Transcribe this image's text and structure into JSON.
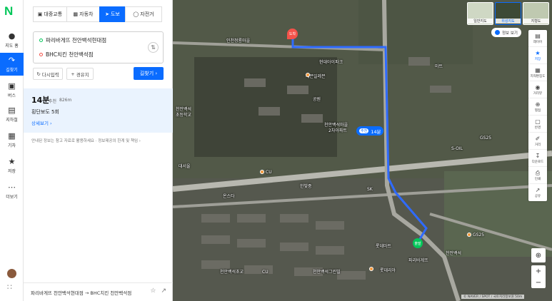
{
  "rail": {
    "logo": "N",
    "items": [
      {
        "label": "지도 홈",
        "icon": "pin-icon"
      },
      {
        "label": "길찾기",
        "icon": "directions-icon"
      },
      {
        "label": "버스",
        "icon": "bus-icon"
      },
      {
        "label": "지하철",
        "icon": "subway-icon"
      },
      {
        "label": "기차",
        "icon": "train-icon"
      },
      {
        "label": "저장",
        "icon": "star-icon"
      },
      {
        "label": "더보기",
        "icon": "more-icon"
      }
    ]
  },
  "panel": {
    "modes": [
      {
        "label": "대중교통",
        "icon": "bus-icon"
      },
      {
        "label": "자동차",
        "icon": "car-icon"
      },
      {
        "label": "도보",
        "icon": "walk-icon"
      },
      {
        "label": "자전거",
        "icon": "bike-icon"
      }
    ],
    "origin": "파리바게뜨 천안백석현대점",
    "destination": "BHC치킨 천안백석점",
    "reset_label": "다시입력",
    "waypoint_label": "경유지",
    "search_label": "길찾기",
    "result": {
      "time": "14분",
      "badge": "추천",
      "distance": "826m",
      "crosswalk": "횡단보도 5회",
      "detail_link": "상세보기"
    },
    "notice": "안내된 정보는 참고 자료로 활용하세요 · 정보제공의 한계 및 책임 ›",
    "bottom_route": "파리바게뜨 천안백석현대점 → BHC치킨 천안백석점"
  },
  "map": {
    "start_label": "도착",
    "end_label": "출발",
    "route_tag": {
      "badge": "추천",
      "time": "14분"
    },
    "layers": [
      "일반지도",
      "위성지도",
      "지형도"
    ],
    "active_layer": "위성지도",
    "info_chip": "정보 보기",
    "tools": [
      "레이어",
      "저장",
      "지적편집도",
      "거리뷰",
      "별점",
      "반경",
      "거리",
      "다운로드",
      "인쇄",
      "공유"
    ],
    "attribution": "© NAVER / SPOT / 국토지리정보원  50m",
    "labels": [
      "인천청룡마을",
      "현대아이파크",
      "세븐일레븐",
      "공원",
      "천안백석마을",
      "2차아파트",
      "마트",
      "천안백석",
      "초등학교",
      "대서울",
      "CU",
      "GS25",
      "롯데마트",
      "천안백석초교",
      "천안백석그린빌",
      "한빛중",
      "CU",
      "롯데리아",
      "천안백석",
      "파리바게뜨",
      "SK",
      "온스타",
      "GS25",
      "S-OIL"
    ]
  },
  "colors": {
    "accent": "#0a6cff",
    "brand": "#03c75a",
    "start": "#f4524a"
  }
}
